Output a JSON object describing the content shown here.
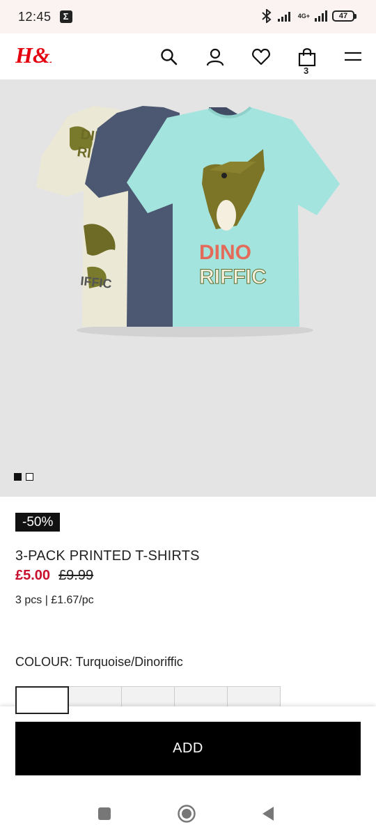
{
  "status_bar": {
    "time": "12:45",
    "sigma": "Σ",
    "network_top": "4G+",
    "battery": "47"
  },
  "header": {
    "brand": "H&M",
    "icons": [
      "search-icon",
      "account-icon",
      "heart-icon",
      "bag-icon",
      "menu-icon"
    ],
    "bag_count": "3"
  },
  "product": {
    "image_print_text": [
      "DINO",
      "RIFFIC"
    ],
    "discount": "-50%",
    "title": "3-PACK PRINTED T-SHIRTS",
    "price_now": "£5.00",
    "price_was": "£9.99",
    "pack_info": "3 pcs | £1.67/pc",
    "colour_label": "COLOUR:",
    "colour_value": "Turquoise/Dinoriffic",
    "gallery_index": 1,
    "gallery_total": 2
  },
  "cta": {
    "add_label": "ADD"
  },
  "colors": {
    "sale_red": "#c8102e",
    "brand_red": "#e50010",
    "hero_bg": "#e4e4e4",
    "shirt_turquoise": "#a4e4df",
    "shirt_navy": "#4c5872",
    "shirt_cream": "#ece8d6"
  },
  "nav": {
    "icons": [
      "recents-icon",
      "home-icon",
      "back-icon"
    ]
  }
}
